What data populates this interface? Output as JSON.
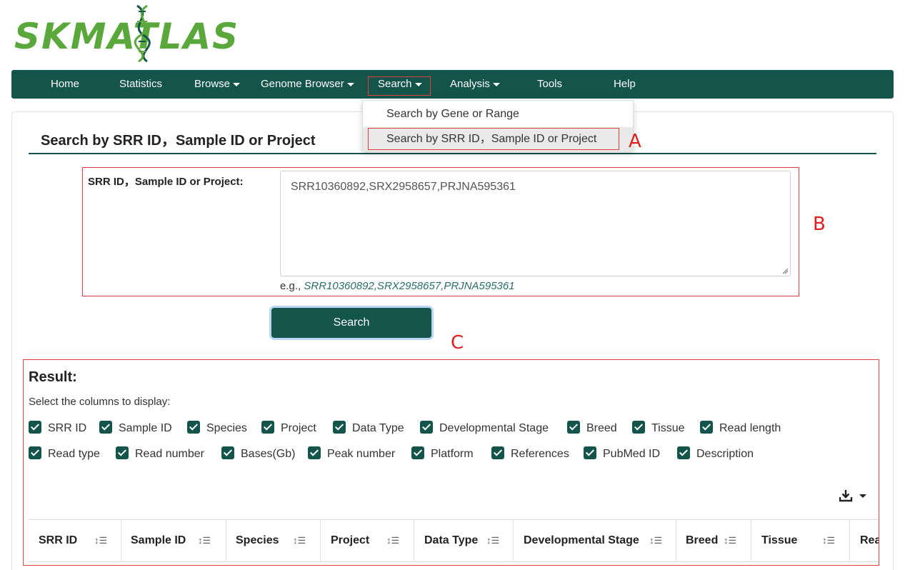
{
  "logo": {
    "text": "SKMATLAS"
  },
  "nav": {
    "items": [
      {
        "label": "Home"
      },
      {
        "label": "Statistics"
      },
      {
        "label": "Browse"
      },
      {
        "label": "Genome Browser"
      },
      {
        "label": "Search"
      },
      {
        "label": "Analysis"
      },
      {
        "label": "Tools"
      },
      {
        "label": "Help"
      }
    ],
    "search_dropdown": [
      {
        "label": "Search by Gene or Range",
        "active": false
      },
      {
        "label": "Search by SRR ID，Sample ID or Project",
        "active": true
      }
    ]
  },
  "annotations": {
    "a": "A",
    "b": "B",
    "c": "C"
  },
  "page": {
    "title": "Search by SRR ID，Sample ID or Project"
  },
  "form": {
    "label": "SRR ID，Sample ID or Project:",
    "value": "SRR10360892,SRX2958657,PRJNA595361",
    "example_prefix": "e.g.,",
    "example_value": "SRR10360892,SRX2958657,PRJNA595361",
    "button": "Search"
  },
  "result": {
    "title": "Result:",
    "select_label": "Select the columns to display:",
    "columns": [
      {
        "label": "SRR ID",
        "checked": true
      },
      {
        "label": "Sample ID",
        "checked": true
      },
      {
        "label": "Species",
        "checked": true
      },
      {
        "label": "Project",
        "checked": true
      },
      {
        "label": "Data Type",
        "checked": true
      },
      {
        "label": "Developmental Stage",
        "checked": true
      },
      {
        "label": "Breed",
        "checked": true
      },
      {
        "label": "Tissue",
        "checked": true
      },
      {
        "label": "Read length",
        "checked": true
      },
      {
        "label": "Read type",
        "checked": true
      },
      {
        "label": "Read number",
        "checked": true
      },
      {
        "label": "Bases(Gb)",
        "checked": true
      },
      {
        "label": "Peak number",
        "checked": true
      },
      {
        "label": "Platform",
        "checked": true
      },
      {
        "label": "References",
        "checked": true
      },
      {
        "label": "PubMed ID",
        "checked": true
      },
      {
        "label": "Description",
        "checked": true
      }
    ],
    "table_headers": [
      "SRR ID",
      "Sample ID",
      "Species",
      "Project",
      "Data Type",
      "Developmental Stage",
      "Breed",
      "Tissue",
      "Rea"
    ],
    "export_icon": "download-icon"
  },
  "colors": {
    "primary": "#13544b",
    "logo_green": "#5aa83c",
    "annotation_red": "#e04040"
  }
}
